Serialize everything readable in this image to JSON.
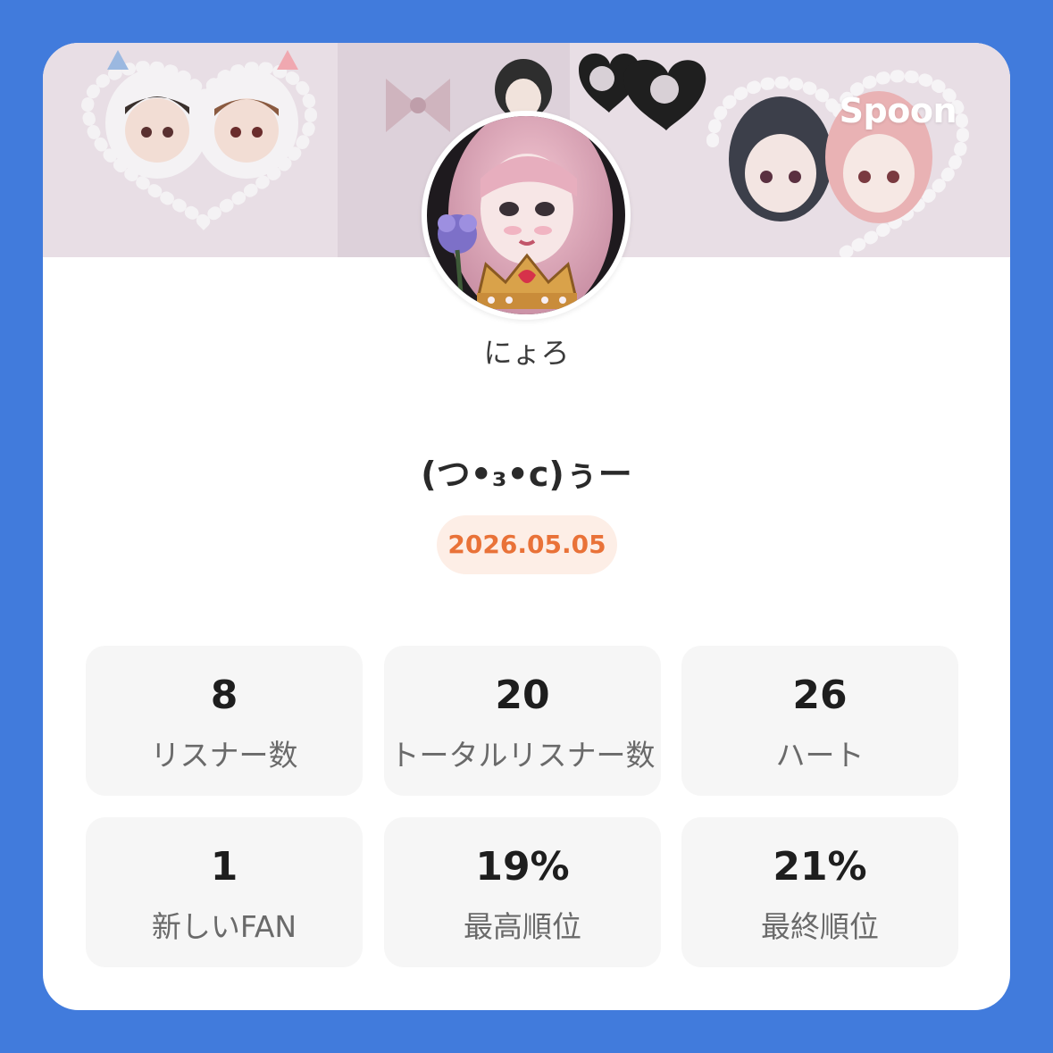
{
  "brand": "Spoon",
  "profile": {
    "username": "にょろ",
    "title": "(つ•₃•c)ぅー",
    "date": "2026.05.05"
  },
  "stats": [
    {
      "value": "8",
      "label": "リスナー数"
    },
    {
      "value": "20",
      "label": "トータルリスナー数"
    },
    {
      "value": "26",
      "label": "ハート"
    },
    {
      "value": "1",
      "label": "新しいFAN"
    },
    {
      "value": "19%",
      "label": "最高順位"
    },
    {
      "value": "21%",
      "label": "最終順位"
    }
  ],
  "colors": {
    "background": "#417bdc",
    "card": "#ffffff",
    "date_text": "#e97238",
    "date_pill": "#fdeee6",
    "stat_tile": "#f6f6f6"
  },
  "icons": {
    "banner": "illustrated-pearl-heart-banner",
    "avatar": "profile-avatar-image"
  }
}
